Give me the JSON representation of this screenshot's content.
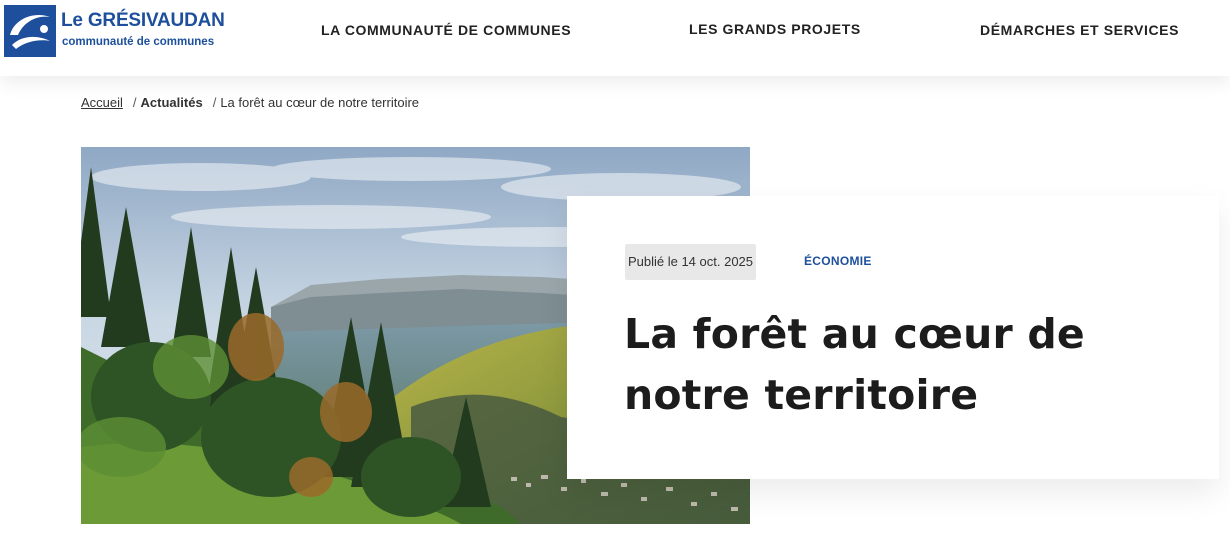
{
  "header": {
    "logo": {
      "title": "Le GRÉSIVAUDAN",
      "subtitle": "communauté de communes"
    },
    "nav": [
      {
        "label": "LA COMMUNAUTÉ DE COMMUNES"
      },
      {
        "label": "LES GRANDS PROJETS"
      },
      {
        "label": "DÉMARCHES ET SERVICES"
      }
    ]
  },
  "breadcrumb": {
    "home": "Accueil",
    "section": "Actualités",
    "current": "La forêt au cœur de notre territoire",
    "separator": "/"
  },
  "article": {
    "published": "Publié le 14 oct. 2025",
    "category": "ÉCONOMIE",
    "title": "La forêt au cœur de notre territoire"
  },
  "colors": {
    "brand_blue": "#1d4f9c",
    "badge_bg": "#e8e8e8",
    "text": "#1c1c1c"
  }
}
